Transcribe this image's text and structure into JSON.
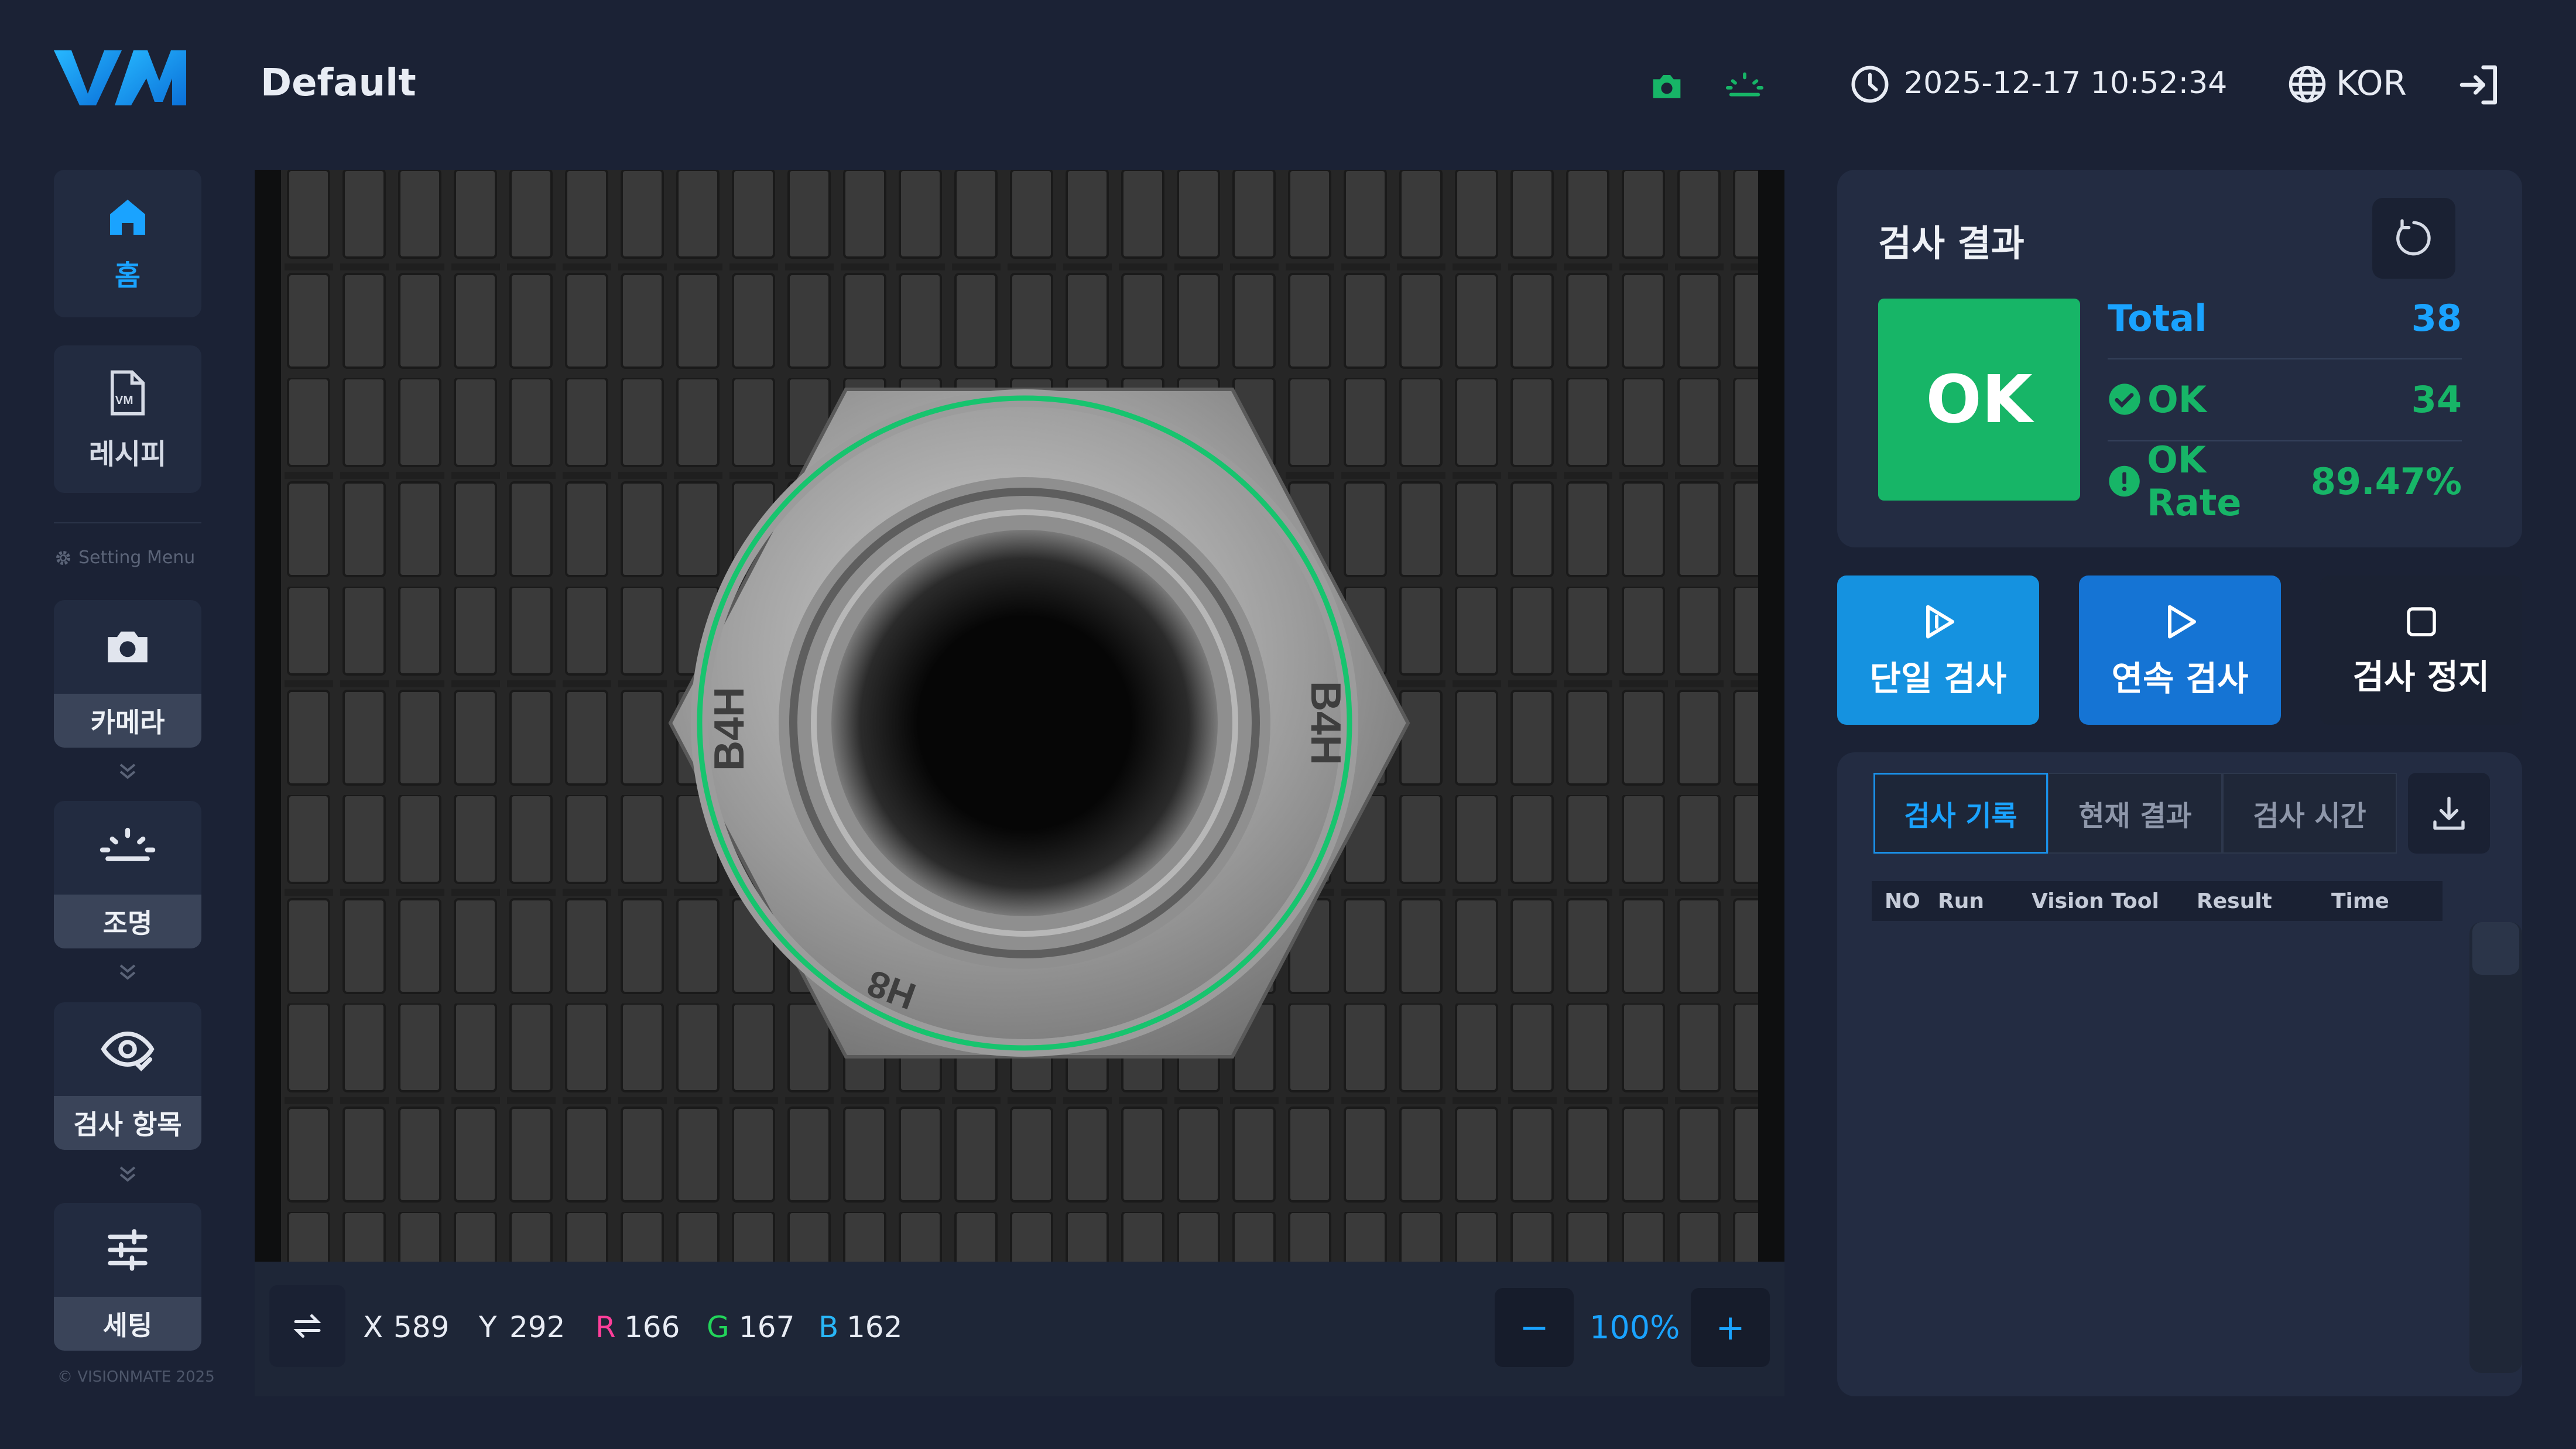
{
  "header": {
    "logo_text": "VM",
    "title": "Default",
    "camera_status_icon": "camera-icon",
    "light_status_icon": "light-icon",
    "datetime": "2025-12-17 10:52:34",
    "language": "KOR",
    "status_color": "#17b567",
    "accent_color": "#1aa3ff"
  },
  "sidebar": {
    "home_label": "홈",
    "recipe_label": "레시피",
    "setting_menu_title": "Setting Menu",
    "steps": [
      {
        "label": "카메라",
        "icon": "camera-icon"
      },
      {
        "label": "조명",
        "icon": "light-icon"
      },
      {
        "label": "검사 항목",
        "icon": "eye-check-icon"
      },
      {
        "label": "세팅",
        "icon": "sliders-icon"
      }
    ],
    "copyright": "© VISIONMATE 2025"
  },
  "viewer": {
    "image_subject": "hex nut on ribbed rubber mat",
    "nut_markings": [
      "B4H",
      "B4H",
      "H8"
    ],
    "readout": {
      "x_label": "X",
      "x_value": "589",
      "y_label": "Y",
      "y_value": "292",
      "r_label": "R",
      "r_value": "166",
      "g_label": "G",
      "g_value": "167",
      "b_label": "B",
      "b_value": "162"
    },
    "zoom": "100%",
    "zoom_minus": "−",
    "zoom_plus": "+"
  },
  "result": {
    "title": "검사 결과",
    "status": "OK",
    "total_label": "Total",
    "total_value": "38",
    "ok_label": "OK",
    "ok_value": "34",
    "rate_label": "OK Rate",
    "rate_value": "89.47%"
  },
  "actions": {
    "single": "단일 검사",
    "continuous": "연속 검사",
    "stop": "검사 정지"
  },
  "history": {
    "tabs": [
      "검사 기록",
      "현재 결과",
      "검사 시간"
    ],
    "columns": [
      "NO",
      "Run",
      "Vision Tool",
      "Result",
      "Time"
    ],
    "rows": []
  }
}
